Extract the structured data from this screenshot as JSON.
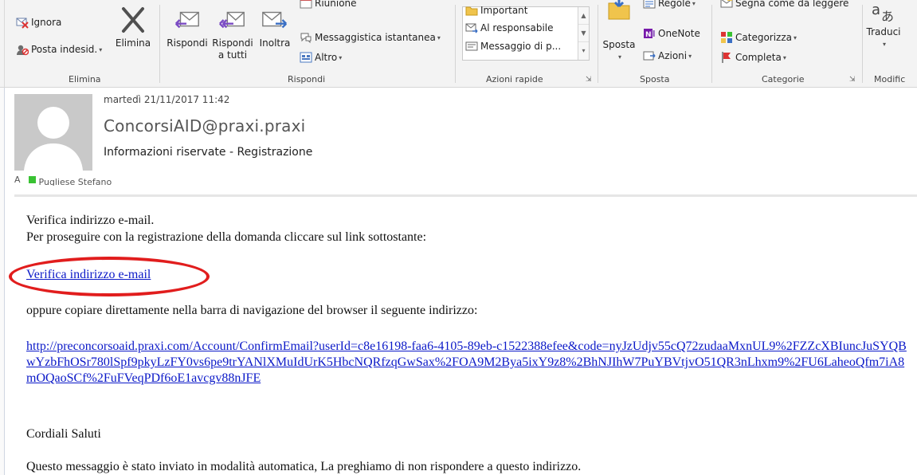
{
  "ribbon": {
    "groups": {
      "elimina": {
        "label": "Elimina",
        "ignora": "Ignora",
        "posta_indesiderata": "Posta indesid.",
        "elimina_btn": "Elimina"
      },
      "rispondi": {
        "label": "Rispondi",
        "rispondi_btn": "Rispondi",
        "rispondi_tutti_1": "Rispondi",
        "rispondi_tutti_2": "a tutti",
        "inoltra_btn": "Inoltra",
        "riunione": "Riunione",
        "messaggistica": "Messaggistica istantanea",
        "altro": "Altro"
      },
      "azioni_rapide": {
        "label": "Azioni rapide",
        "important": "Important",
        "al_responsabile": "Al responsabile",
        "messaggio": "Messaggio di p..."
      },
      "sposta": {
        "label": "Sposta",
        "sposta_btn": "Sposta",
        "regole": "Regole",
        "onenote": "OneNote",
        "azioni": "Azioni"
      },
      "categorie": {
        "label": "Categorie",
        "segna_letto": "Segna come da leggere",
        "categorizza": "Categorizza",
        "completa": "Completa"
      },
      "modifica": {
        "label": "Modific",
        "traduci": "Traduci"
      }
    }
  },
  "message": {
    "date": "martedì 21/11/2017 11:42",
    "from": "ConcorsiAID@praxi.praxi",
    "subject": "Informazioni riservate - Registrazione",
    "to_prefix": "A",
    "to_name": "Pugliese Stefano"
  },
  "body": {
    "line1": "Verifica indirizzo e-mail.",
    "line2": "Per proseguire con la registrazione della domanda cliccare sul link sottostante:",
    "verify_link": "Verifica indirizzo e-mail",
    "line3": "oppure copiare direttamente nella barra di navigazione del browser il seguente indirizzo:",
    "long_url": "http://preconcorsoaid.praxi.com/Account/ConfirmEmail?userId=c8e16198-faa6-4105-89eb-c1522388efee&code=nyJzUdjv55cQ72zudaaMxnUL9%2FZZcXBIuncJuSYQBwYzbFhOSr780lSpf9pkyLzFY0vs6pe9trYANlXMuIdUrK5HbcNQRfzqGwSax%2FOA9M2Bya5ixY9z8%2BhNJIhW7PuYBVtjvO51QR3nLhxm9%2FU6LaheoQfm7iA8mOQaoSCf%2FuFVeqPDf6oE1avcgv88nJFE",
    "saluti": "Cordiali Saluti",
    "footer": "Questo messaggio è stato inviato in modalità automatica, La preghiamo di non rispondere a questo indirizzo."
  },
  "colors": {
    "link": "#0b19c8",
    "annotation": "#e11d1d",
    "category_green": "#39c233"
  }
}
